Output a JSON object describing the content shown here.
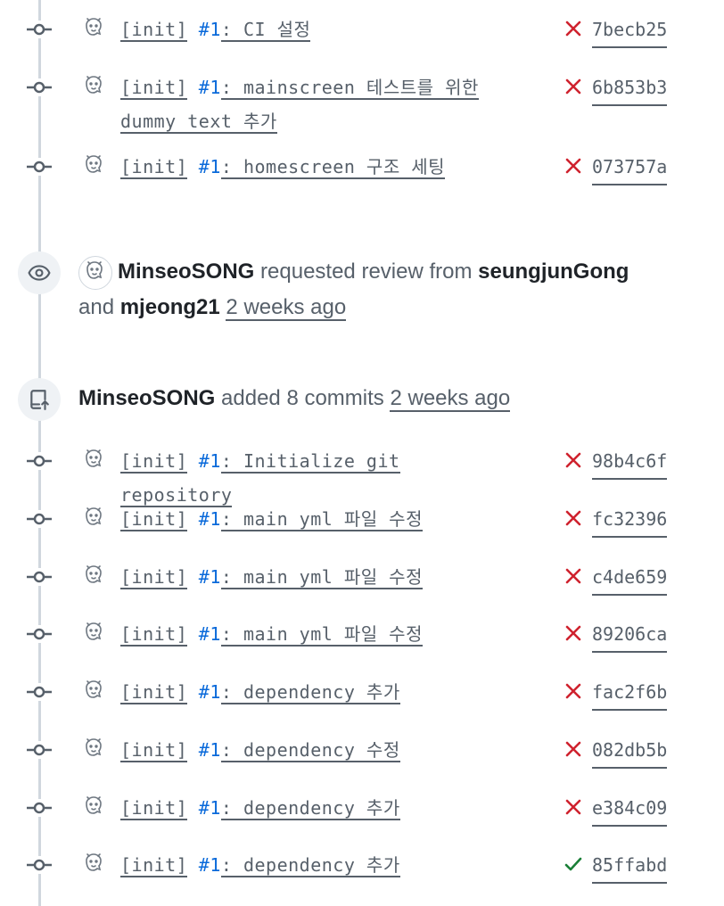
{
  "commits_top": [
    {
      "prefix": "[init]",
      "issue": "#1",
      "rest": ": CI 설정",
      "status": "fail",
      "sha": "7becb25"
    },
    {
      "prefix": "[init]",
      "issue": "#1",
      "rest": ": mainscreen 테스트를 위한",
      "rest2": "dummy text 추가",
      "status": "fail",
      "sha": "6b853b3"
    },
    {
      "prefix": "[init]",
      "issue": "#1",
      "rest": ": homescreen 구조 세팅",
      "status": "fail",
      "sha": "073757a"
    }
  ],
  "review_event": {
    "actor": "MinseoSONG",
    "verb": "requested review from",
    "reviewer1": "seungjunGong",
    "conj": "and",
    "reviewer2": "mjeong21",
    "time": "2 weeks ago"
  },
  "commits_event": {
    "actor": "MinseoSONG",
    "verb": "added 8 commits",
    "time": "2 weeks ago"
  },
  "commits_bottom": [
    {
      "prefix": "[init]",
      "issue": "#1",
      "rest": ": Initialize git repository",
      "status": "fail",
      "sha": "98b4c6f"
    },
    {
      "prefix": "[init]",
      "issue": "#1",
      "rest": ": main yml 파일 수정",
      "status": "fail",
      "sha": "fc32396"
    },
    {
      "prefix": "[init]",
      "issue": "#1",
      "rest": ": main yml 파일 수정",
      "status": "fail",
      "sha": "c4de659"
    },
    {
      "prefix": "[init]",
      "issue": "#1",
      "rest": ": main yml 파일 수정",
      "status": "fail",
      "sha": "89206ca"
    },
    {
      "prefix": "[init]",
      "issue": "#1",
      "rest": ": dependency 추가",
      "status": "fail",
      "sha": "fac2f6b"
    },
    {
      "prefix": "[init]",
      "issue": "#1",
      "rest": ": dependency 수정",
      "status": "fail",
      "sha": "082db5b"
    },
    {
      "prefix": "[init]",
      "issue": "#1",
      "rest": ": dependency 추가",
      "status": "fail",
      "sha": "e384c09"
    },
    {
      "prefix": "[init]",
      "issue": "#1",
      "rest": ": dependency 추가",
      "status": "success",
      "sha": "85ffabd"
    }
  ],
  "colors": {
    "fail": "#cf222e",
    "success": "#1a7f37",
    "link": "#0969da",
    "muted": "#57606a"
  },
  "icons": {
    "commit": "git-commit-icon",
    "review": "eye-icon",
    "push": "repo-push-icon",
    "fail": "x-icon",
    "success": "check-icon"
  }
}
